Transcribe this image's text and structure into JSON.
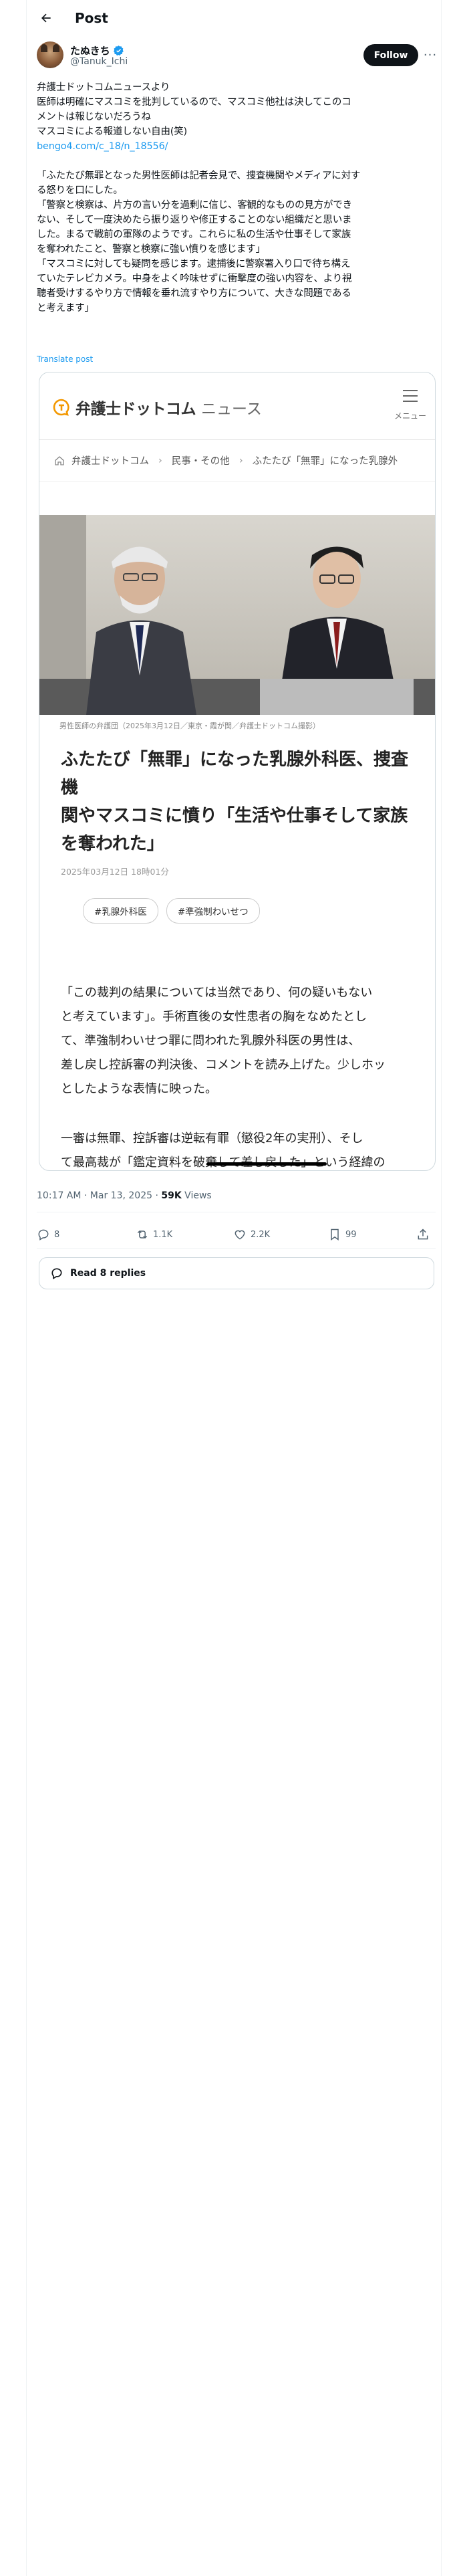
{
  "header": {
    "title": "Post"
  },
  "author": {
    "name": "たぬきち",
    "handle": "@Tanuk_Ichi"
  },
  "follow_label": "Follow",
  "more_label": "···",
  "tweet": {
    "lines": [
      "弁護士ドットコムニュースより",
      "医師は明確にマスコミを批判しているので、マスコミ他社は決してこのコ",
      "メントは報じないだろうね",
      "マスコミによる報道しない自由(笑)",
      "",
      "",
      "「ふたたび無罪となった男性医師は記者会見で、捜査機関やメディアに対す",
      "る怒りを口にした。",
      "「警察と検察は、片方の言い分を過剰に信じ、客観的なものの見方ができ",
      "ない、そして一度決めたら振り返りや修正することのない組織だと思いま",
      "した。まるで戦前の軍隊のようです。これらに私の生活や仕事そして家族",
      "を奪われたこと、警察と検察に強い憤りを感じます」",
      "「マスコミに対しても疑問を感じます。逮捕後に警察署入り口で待ち構え",
      "ていたテレビカメラ。中身をよく吟味せずに衝撃度の強い内容を、より視",
      "聴者受けするやり方で情報を垂れ流すやり方について、大きな問題である",
      "と考えます」"
    ],
    "link": "bengo4.com/c_18/n_18556/",
    "translate": "Translate post"
  },
  "card": {
    "logo_bold": "弁護士ドットコム",
    "logo_light": "ニュース",
    "menu_label": "メニュー",
    "breadcrumb": [
      "弁護士ドットコム",
      "民事・その他",
      "ふたたび「無罪」になった乳腺外"
    ],
    "caption": "男性医師の弁護団（2025年3月12日／東京・霞が関／弁護士ドットコム撮影）",
    "title_lines": [
      "ふたたび「無罪」になった乳腺外科医、捜査機",
      "関やマスコミに憤り「生活や仕事そして家族",
      "を奪われた」"
    ],
    "date": "2025年03月12日 18時01分",
    "tags": [
      "#乳腺外科医",
      "#準強制わいせつ"
    ],
    "para1": [
      "「この裁判の結果については当然であり、何の疑いもない",
      "と考えています」。手術直後の女性患者の胸をなめたとし",
      "て、準強制わいせつ罪に問われた乳腺外科医の男性は、",
      "差し戻し控訴審の判決後、コメントを読み上げた。少しホッ",
      "としたような表情に映った。"
    ],
    "para2": [
      "一審は無罪、控訴審は逆転有罪（懲役2年の実刑）、そし",
      "て最高裁が「鑑定資料を破棄して差し戻した」という経緯の"
    ]
  },
  "meta": {
    "time": "10:17 AM · Mar 13, 2025",
    "views_count": "59K",
    "views_label": "Views"
  },
  "actions": {
    "replies": "8",
    "reposts": "1.1K",
    "likes": "2.2K",
    "bookmarks": "99"
  },
  "read_replies": "Read 8 replies",
  "colors": {
    "accent": "#1d9bf0",
    "text": "#0f1419",
    "muted": "#536471",
    "logo_orange": "#f39800"
  }
}
